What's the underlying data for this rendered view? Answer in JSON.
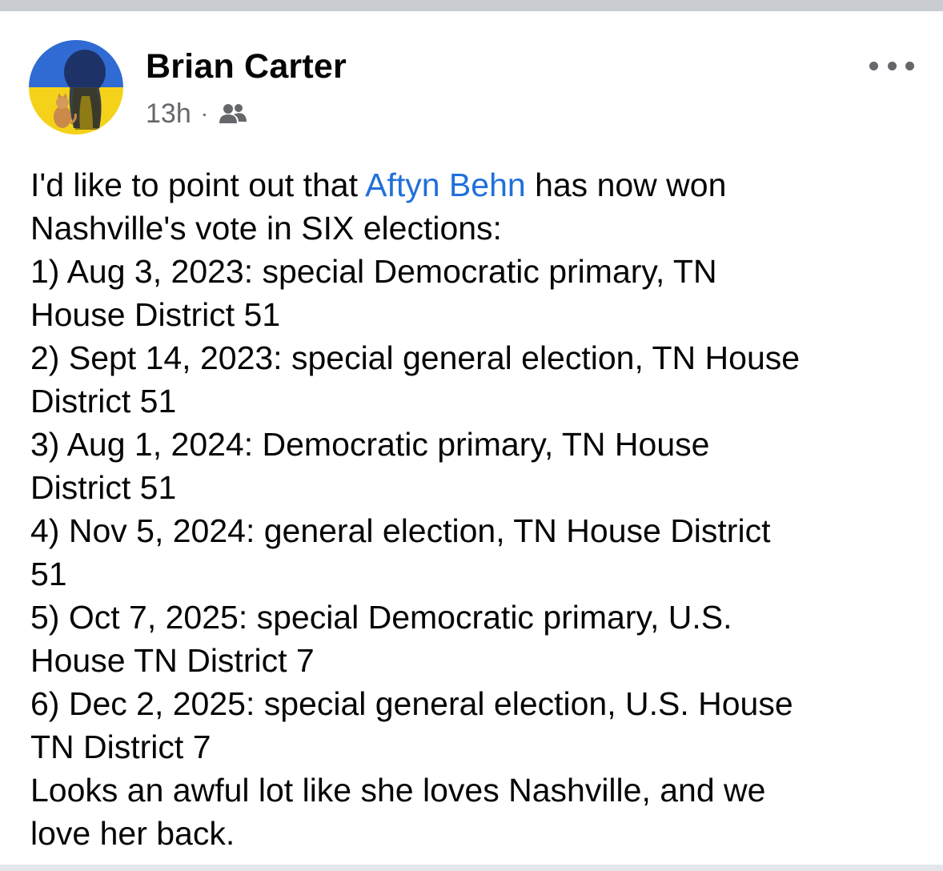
{
  "post": {
    "author": "Brian Carter",
    "timestamp": "13h",
    "separator": "·",
    "audience_icon": "friends-icon",
    "more_icon": "more-options-icon",
    "avatar_colors": {
      "top": "#2f6bd3",
      "bottom": "#f5d21a"
    },
    "mention": "Aftyn Behn",
    "mention_color": "#216fdb",
    "body_intro_before": "I'd like to point out that ",
    "body_intro_after": " has now won",
    "body_lines": [
      "Nashville's vote in SIX elections:",
      "1) Aug 3, 2023: special Democratic primary, TN",
      "House District 51",
      "2) Sept 14, 2023: special general election, TN House",
      "District 51",
      "3) Aug 1, 2024: Democratic primary, TN House",
      "District 51",
      "4) Nov 5, 2024: general election, TN House District",
      "51",
      "5) Oct 7, 2025: special Democratic primary, U.S.",
      "House TN District 7",
      "6) Dec 2, 2025: special general election, U.S. House",
      "TN District 7",
      "Looks an awful lot like she loves Nashville, and we",
      "love her back."
    ]
  }
}
